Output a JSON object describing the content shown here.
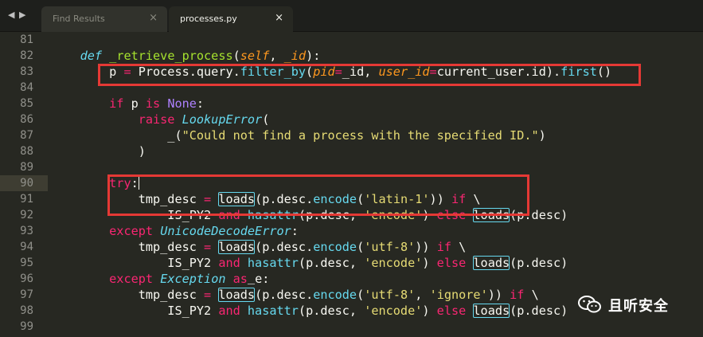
{
  "tabs": [
    {
      "label": "Find Results",
      "active": false,
      "close": "×"
    },
    {
      "label": "processes.py",
      "active": true,
      "close": "×"
    }
  ],
  "nav": {
    "back": "◀",
    "forward": "▶"
  },
  "lines": [
    {
      "n": "81",
      "t": []
    },
    {
      "n": "82",
      "t": [
        [
          "",
          "    "
        ],
        [
          "st",
          "def"
        ],
        [
          "",
          " "
        ],
        [
          "fn",
          "_retrieve_process"
        ],
        [
          "",
          "("
        ],
        [
          "pa",
          "self"
        ],
        [
          "",
          ", "
        ],
        [
          "pa",
          "_id"
        ],
        [
          "",
          "):"
        ]
      ]
    },
    {
      "n": "83",
      "t": [
        [
          "",
          "        p "
        ],
        [
          "op",
          "="
        ],
        [
          "",
          " Process.query."
        ],
        [
          "bi",
          "filter_by"
        ],
        [
          "",
          "("
        ],
        [
          "pa",
          "pid"
        ],
        [
          "op",
          "="
        ],
        [
          "",
          "_id, "
        ],
        [
          "pa",
          "user_id"
        ],
        [
          "op",
          "="
        ],
        [
          "",
          "current_user.id)."
        ],
        [
          "bi",
          "first"
        ],
        [
          "",
          "()"
        ]
      ]
    },
    {
      "n": "84",
      "t": []
    },
    {
      "n": "85",
      "t": [
        [
          "",
          "        "
        ],
        [
          "kw",
          "if"
        ],
        [
          "",
          " p "
        ],
        [
          "kw",
          "is"
        ],
        [
          "",
          " "
        ],
        [
          "cn",
          "None"
        ],
        [
          "",
          ":"
        ]
      ]
    },
    {
      "n": "86",
      "t": [
        [
          "",
          "            "
        ],
        [
          "kw",
          "raise"
        ],
        [
          "",
          " "
        ],
        [
          "cls",
          "LookupError"
        ],
        [
          "",
          "("
        ]
      ]
    },
    {
      "n": "87",
      "t": [
        [
          "",
          "                _("
        ],
        [
          "str",
          "\"Could not find a process with the specified ID.\""
        ],
        [
          "",
          ")"
        ]
      ]
    },
    {
      "n": "88",
      "t": [
        [
          "",
          "            )"
        ]
      ]
    },
    {
      "n": "89",
      "t": []
    },
    {
      "n": "90",
      "t": [
        [
          "",
          "        "
        ],
        [
          "kw",
          "try"
        ],
        [
          "",
          ":"
        ],
        [
          "cursor",
          ""
        ]
      ],
      "current": true
    },
    {
      "n": "91",
      "t": [
        [
          "",
          "            tmp_desc "
        ],
        [
          "op",
          "="
        ],
        [
          "",
          " "
        ],
        [
          "hl",
          "loads"
        ],
        [
          "",
          "(p.desc."
        ],
        [
          "bi",
          "encode"
        ],
        [
          "",
          "("
        ],
        [
          "str",
          "'latin-1'"
        ],
        [
          "",
          ")) "
        ],
        [
          "kw",
          "if"
        ],
        [
          "",
          " \\"
        ]
      ]
    },
    {
      "n": "92",
      "t": [
        [
          "",
          "                IS_PY2 "
        ],
        [
          "kw",
          "and"
        ],
        [
          "",
          " "
        ],
        [
          "bi",
          "hasattr"
        ],
        [
          "",
          "(p.desc, "
        ],
        [
          "str",
          "'encode'"
        ],
        [
          "",
          ") "
        ],
        [
          "kw",
          "else"
        ],
        [
          "",
          " "
        ],
        [
          "hl",
          "loads"
        ],
        [
          "",
          "(p.desc)"
        ]
      ]
    },
    {
      "n": "93",
      "t": [
        [
          "",
          "        "
        ],
        [
          "kw",
          "except"
        ],
        [
          "",
          " "
        ],
        [
          "cls",
          "UnicodeDecodeError"
        ],
        [
          "",
          ":"
        ]
      ]
    },
    {
      "n": "94",
      "t": [
        [
          "",
          "            tmp_desc "
        ],
        [
          "op",
          "="
        ],
        [
          "",
          " "
        ],
        [
          "hl",
          "loads"
        ],
        [
          "",
          "(p.desc."
        ],
        [
          "bi",
          "encode"
        ],
        [
          "",
          "("
        ],
        [
          "str",
          "'utf-8'"
        ],
        [
          "",
          ")) "
        ],
        [
          "kw",
          "if"
        ],
        [
          "",
          " \\"
        ]
      ]
    },
    {
      "n": "95",
      "t": [
        [
          "",
          "                IS_PY2 "
        ],
        [
          "kw",
          "and"
        ],
        [
          "",
          " "
        ],
        [
          "bi",
          "hasattr"
        ],
        [
          "",
          "(p.desc, "
        ],
        [
          "str",
          "'encode'"
        ],
        [
          "",
          ") "
        ],
        [
          "kw",
          "else"
        ],
        [
          "",
          " "
        ],
        [
          "hl",
          "loads"
        ],
        [
          "",
          "(p.desc)"
        ]
      ]
    },
    {
      "n": "96",
      "t": [
        [
          "",
          "        "
        ],
        [
          "kw",
          "except"
        ],
        [
          "",
          " "
        ],
        [
          "cls",
          "Exception"
        ],
        [
          "",
          " "
        ],
        [
          "kw",
          "as"
        ],
        [
          "under",
          " "
        ],
        [
          "",
          "e:"
        ]
      ]
    },
    {
      "n": "97",
      "t": [
        [
          "",
          "            tmp_desc "
        ],
        [
          "op",
          "="
        ],
        [
          "",
          " "
        ],
        [
          "hl",
          "loads"
        ],
        [
          "",
          "(p.desc."
        ],
        [
          "bi",
          "encode"
        ],
        [
          "",
          "("
        ],
        [
          "str",
          "'utf-8'"
        ],
        [
          "",
          ", "
        ],
        [
          "str",
          "'ignore'"
        ],
        [
          "",
          ")) "
        ],
        [
          "kw",
          "if"
        ],
        [
          "",
          " \\"
        ]
      ]
    },
    {
      "n": "98",
      "t": [
        [
          "",
          "                IS_PY2 "
        ],
        [
          "kw",
          "and"
        ],
        [
          "",
          " "
        ],
        [
          "bi",
          "hasattr"
        ],
        [
          "",
          "(p.desc, "
        ],
        [
          "str",
          "'encode'"
        ],
        [
          "",
          ") "
        ],
        [
          "kw",
          "else"
        ],
        [
          "",
          " "
        ],
        [
          "hl",
          "loads"
        ],
        [
          "",
          "(p.desc)"
        ]
      ]
    },
    {
      "n": "99",
      "t": []
    }
  ],
  "watermark": {
    "text": "且听安全",
    "icon": "wechat-icon"
  },
  "colors": {
    "background": "#272822",
    "keyword": "#f92672",
    "function": "#a6e22e",
    "param": "#fd971f",
    "builtin": "#66d9ef",
    "string": "#e6db74",
    "constant": "#ae81ff",
    "annotation_box": "#e53935"
  }
}
